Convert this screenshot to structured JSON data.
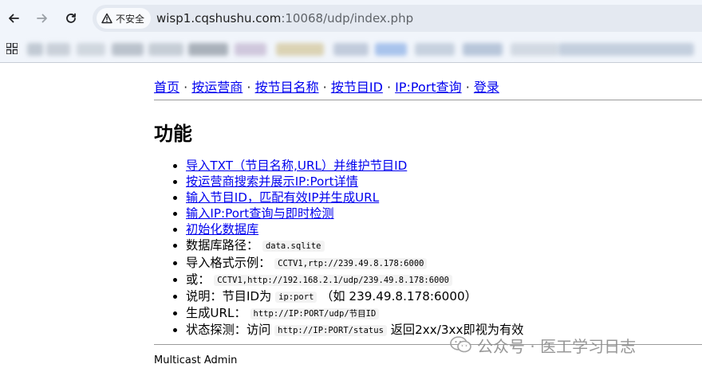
{
  "browser": {
    "security_label": "不安全",
    "url_host": "wisp1.cqshushu.com",
    "url_rest": ":10068/udp/index.php",
    "bookmark_colors": [
      "#9aa6b3",
      "#a9b2bd",
      "#b6bfc8",
      "#8e99a6",
      "#a3adb8",
      "#6f7a86",
      "#b5a3c4",
      "#c9b77a",
      "#9aa9c2",
      "#6e9be0",
      "#a4b4c8",
      "#8aa0bf",
      "#b9c3cf",
      "#9fb0c6"
    ]
  },
  "nav": {
    "links": [
      "首页",
      "按运营商",
      "按节目名称",
      "按节目ID",
      "IP:Port查询",
      "登录"
    ],
    "separator": " · "
  },
  "main": {
    "heading": "功能",
    "links": [
      "导入TXT（节目名称,URL）并维护节目ID",
      "按运营商搜索并展示IP:Port详情",
      "输入节目ID，匹配有效IP并生成URL",
      "输入IP:Port查询与即时检测",
      "初始化数据库"
    ],
    "info": [
      {
        "label": "数据库路径：",
        "code": "data.sqlite",
        "suffix": ""
      },
      {
        "label": "导入格式示例：",
        "code": "CCTV1,rtp://239.49.8.178:6000",
        "suffix": ""
      },
      {
        "label": "或：",
        "code": "CCTV1,http://192.168.2.1/udp/239.49.8.178:6000",
        "suffix": ""
      },
      {
        "label": "说明：节目ID为",
        "code": "ip:port",
        "suffix": "（如 239.49.8.178:6000）"
      },
      {
        "label": "生成URL：",
        "code": "http://IP:PORT/udp/节目ID",
        "suffix": ""
      },
      {
        "label": "状态探测：访问",
        "code": "http://IP:PORT/status",
        "suffix": "返回2xx/3xx即视为有效"
      }
    ]
  },
  "footer": "Multicast Admin",
  "watermark": "公众号 · 医工学习日志"
}
